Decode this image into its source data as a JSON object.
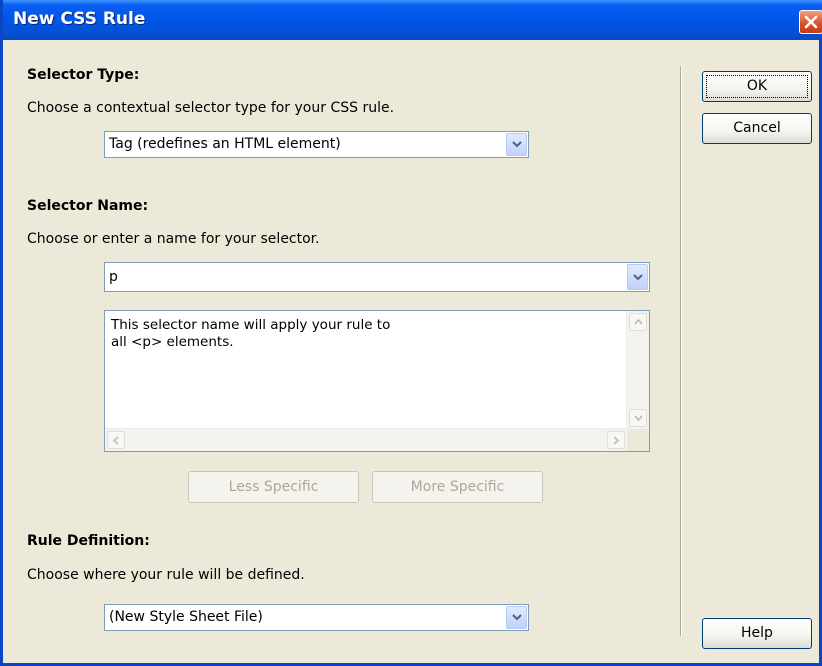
{
  "window": {
    "title": "New CSS Rule"
  },
  "selector_type": {
    "heading": "Selector Type:",
    "description": "Choose a contextual selector type for your CSS rule.",
    "selected": "Tag (redefines an HTML element)"
  },
  "selector_name": {
    "heading": "Selector Name:",
    "description": "Choose or enter a name for your selector.",
    "value": "p",
    "info_text": "This selector name will apply your rule to\nall <p> elements.",
    "less_specific_label": "Less Specific",
    "more_specific_label": "More Specific"
  },
  "rule_definition": {
    "heading": "Rule Definition:",
    "description": "Choose where your rule will be defined.",
    "selected": "(New Style Sheet File)"
  },
  "buttons": {
    "ok": "OK",
    "cancel": "Cancel",
    "help": "Help"
  },
  "icons": {
    "close": "close-icon",
    "dropdown": "chevron-down-icon",
    "scroll_up": "arrow-up-icon",
    "scroll_down": "arrow-down-icon",
    "scroll_left": "arrow-left-icon",
    "scroll_right": "arrow-right-icon"
  },
  "colors": {
    "titlebar": "#0a5ef1",
    "dialog_bg": "#ece9d8",
    "close_button": "#d9542c"
  }
}
